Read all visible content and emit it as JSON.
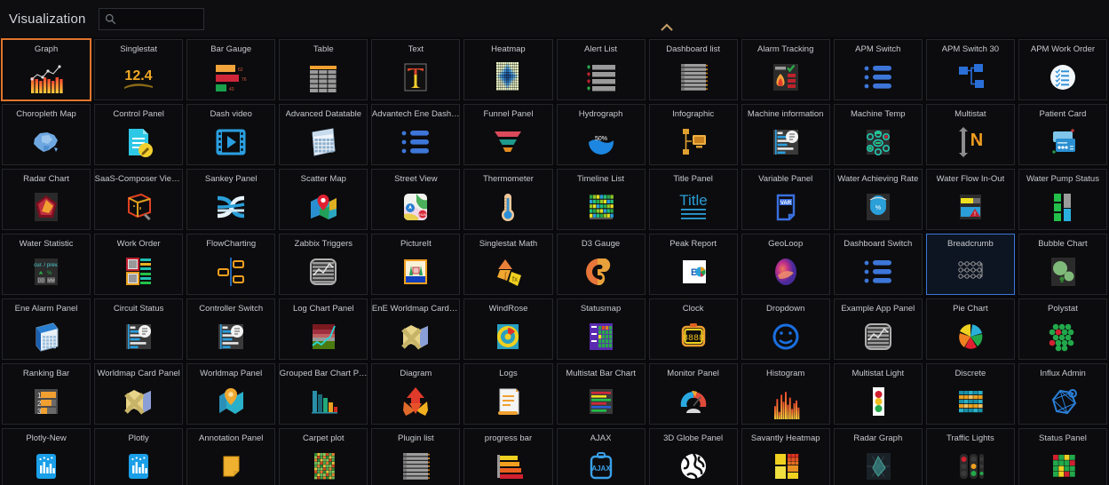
{
  "header": {
    "title": "Visualization",
    "search": {
      "value": "",
      "placeholder": ""
    },
    "collapse_icon": "chevron-up-icon",
    "search_icon": "search-icon"
  },
  "colors": {
    "selected_border": "#e0752d",
    "focus_border": "#3d76d8",
    "background": "#09090b",
    "card_background": "#0c0c0e",
    "card_border": "#242629",
    "label_text": "#c7c9cd"
  },
  "grid": {
    "columns": 12,
    "selected": "Graph",
    "focused": "Breadcrumb",
    "cards": [
      {
        "label": "Graph",
        "icon": "graph-icon",
        "state": "selected"
      },
      {
        "label": "Singlestat",
        "icon": "singlestat-icon",
        "state": "normal"
      },
      {
        "label": "Bar Gauge",
        "icon": "bar-gauge-icon",
        "state": "normal"
      },
      {
        "label": "Table",
        "icon": "table-icon",
        "state": "normal"
      },
      {
        "label": "Text",
        "icon": "text-icon",
        "state": "normal"
      },
      {
        "label": "Heatmap",
        "icon": "heatmap-icon",
        "state": "normal"
      },
      {
        "label": "Alert List",
        "icon": "alert-list-icon",
        "state": "normal"
      },
      {
        "label": "Dashboard list",
        "icon": "dashboard-list-icon",
        "state": "normal"
      },
      {
        "label": "Alarm Tracking",
        "icon": "alarm-tracking-icon",
        "state": "normal"
      },
      {
        "label": "APM Switch",
        "icon": "apm-switch-icon",
        "state": "normal"
      },
      {
        "label": "APM Switch 30",
        "icon": "apm-switch-30-icon",
        "state": "normal"
      },
      {
        "label": "APM Work Order",
        "icon": "apm-work-order-icon",
        "state": "normal"
      },
      {
        "label": "Choropleth Map",
        "icon": "choropleth-map-icon",
        "state": "normal"
      },
      {
        "label": "Control Panel",
        "icon": "control-panel-icon",
        "state": "normal"
      },
      {
        "label": "Dash video",
        "icon": "dash-video-icon",
        "state": "normal"
      },
      {
        "label": "Advanced Datatable",
        "icon": "advanced-datatable-icon",
        "state": "normal"
      },
      {
        "label": "Advantech Ene Dashbo...",
        "icon": "advantech-ene-dashboard-icon",
        "state": "normal"
      },
      {
        "label": "Funnel Panel",
        "icon": "funnel-panel-icon",
        "state": "normal"
      },
      {
        "label": "Hydrograph",
        "icon": "hydrograph-icon",
        "state": "normal"
      },
      {
        "label": "Infographic",
        "icon": "infographic-icon",
        "state": "normal"
      },
      {
        "label": "Machine information",
        "icon": "machine-information-icon",
        "state": "normal"
      },
      {
        "label": "Machine Temp",
        "icon": "machine-temp-icon",
        "state": "normal"
      },
      {
        "label": "Multistat",
        "icon": "multistat-icon",
        "state": "normal"
      },
      {
        "label": "Patient Card",
        "icon": "patient-card-icon",
        "state": "normal"
      },
      {
        "label": "Radar Chart",
        "icon": "radar-chart-icon",
        "state": "normal"
      },
      {
        "label": "SaaS-Composer Viewer",
        "icon": "saas-composer-viewer-icon",
        "state": "normal"
      },
      {
        "label": "Sankey Panel",
        "icon": "sankey-panel-icon",
        "state": "normal"
      },
      {
        "label": "Scatter Map",
        "icon": "scatter-map-icon",
        "state": "normal"
      },
      {
        "label": "Street View",
        "icon": "street-view-icon",
        "state": "normal"
      },
      {
        "label": "Thermometer",
        "icon": "thermometer-icon",
        "state": "normal"
      },
      {
        "label": "Timeline List",
        "icon": "timeline-list-icon",
        "state": "normal"
      },
      {
        "label": "Title Panel",
        "icon": "title-panel-icon",
        "state": "normal"
      },
      {
        "label": "Variable Panel",
        "icon": "variable-panel-icon",
        "state": "normal"
      },
      {
        "label": "Water Achieving Rate",
        "icon": "water-achieving-rate-icon",
        "state": "normal"
      },
      {
        "label": "Water Flow In-Out",
        "icon": "water-flow-in-out-icon",
        "state": "normal"
      },
      {
        "label": "Water Pump Status",
        "icon": "water-pump-status-icon",
        "state": "normal"
      },
      {
        "label": "Water Statistic",
        "icon": "water-statistic-icon",
        "state": "normal"
      },
      {
        "label": "Work Order",
        "icon": "work-order-icon",
        "state": "normal"
      },
      {
        "label": "FlowCharting",
        "icon": "flowcharting-icon",
        "state": "normal"
      },
      {
        "label": "Zabbix Triggers",
        "icon": "zabbix-triggers-icon",
        "state": "normal"
      },
      {
        "label": "PictureIt",
        "icon": "pictureit-icon",
        "state": "normal"
      },
      {
        "label": "Singlestat Math",
        "icon": "singlestat-math-icon",
        "state": "normal"
      },
      {
        "label": "D3 Gauge",
        "icon": "d3-gauge-icon",
        "state": "normal"
      },
      {
        "label": "Peak Report",
        "icon": "peak-report-icon",
        "state": "normal"
      },
      {
        "label": "GeoLoop",
        "icon": "geoloop-icon",
        "state": "normal"
      },
      {
        "label": "Dashboard Switch",
        "icon": "dashboard-switch-icon",
        "state": "normal"
      },
      {
        "label": "Breadcrumb",
        "icon": "breadcrumb-icon",
        "state": "focused"
      },
      {
        "label": "Bubble Chart",
        "icon": "bubble-chart-icon",
        "state": "normal"
      },
      {
        "label": "Ene Alarm Panel",
        "icon": "ene-alarm-panel-icon",
        "state": "normal"
      },
      {
        "label": "Circuit Status",
        "icon": "circuit-status-icon",
        "state": "normal"
      },
      {
        "label": "Controller Switch",
        "icon": "controller-switch-icon",
        "state": "normal"
      },
      {
        "label": "Log Chart Panel",
        "icon": "log-chart-panel-icon",
        "state": "normal"
      },
      {
        "label": "EnE Worldmap Card Panel",
        "icon": "ene-worldmap-card-panel-icon",
        "state": "normal"
      },
      {
        "label": "WindRose",
        "icon": "windrose-icon",
        "state": "normal"
      },
      {
        "label": "Statusmap",
        "icon": "statusmap-icon",
        "state": "normal"
      },
      {
        "label": "Clock",
        "icon": "clock-icon",
        "state": "normal"
      },
      {
        "label": "Dropdown",
        "icon": "dropdown-icon",
        "state": "normal"
      },
      {
        "label": "Example App Panel",
        "icon": "example-app-panel-icon",
        "state": "normal"
      },
      {
        "label": "Pie Chart",
        "icon": "pie-chart-icon",
        "state": "normal"
      },
      {
        "label": "Polystat",
        "icon": "polystat-icon",
        "state": "normal"
      },
      {
        "label": "Ranking Bar",
        "icon": "ranking-bar-icon",
        "state": "normal"
      },
      {
        "label": "Worldmap Card Panel",
        "icon": "worldmap-card-panel-icon",
        "state": "normal"
      },
      {
        "label": "Worldmap Panel",
        "icon": "worldmap-panel-icon",
        "state": "normal"
      },
      {
        "label": "Grouped Bar Chart Panel",
        "icon": "grouped-bar-chart-panel-icon",
        "state": "normal"
      },
      {
        "label": "Diagram",
        "icon": "diagram-icon",
        "state": "normal"
      },
      {
        "label": "Logs",
        "icon": "logs-icon",
        "state": "normal"
      },
      {
        "label": "Multistat Bar Chart",
        "icon": "multistat-bar-chart-icon",
        "state": "normal"
      },
      {
        "label": "Monitor Panel",
        "icon": "monitor-panel-icon",
        "state": "normal"
      },
      {
        "label": "Histogram",
        "icon": "histogram-icon",
        "state": "normal"
      },
      {
        "label": "Multistat Light",
        "icon": "multistat-light-icon",
        "state": "normal"
      },
      {
        "label": "Discrete",
        "icon": "discrete-icon",
        "state": "normal"
      },
      {
        "label": "Influx Admin",
        "icon": "influx-admin-icon",
        "state": "normal"
      },
      {
        "label": "Plotly-New",
        "icon": "plotly-new-icon",
        "state": "normal"
      },
      {
        "label": "Plotly",
        "icon": "plotly-icon",
        "state": "normal"
      },
      {
        "label": "Annotation Panel",
        "icon": "annotation-panel-icon",
        "state": "normal"
      },
      {
        "label": "Carpet plot",
        "icon": "carpet-plot-icon",
        "state": "normal"
      },
      {
        "label": "Plugin list",
        "icon": "plugin-list-icon",
        "state": "normal"
      },
      {
        "label": "progress bar",
        "icon": "progress-bar-icon",
        "state": "normal"
      },
      {
        "label": "AJAX",
        "icon": "ajax-icon",
        "state": "normal"
      },
      {
        "label": "3D Globe Panel",
        "icon": "3d-globe-panel-icon",
        "state": "normal"
      },
      {
        "label": "Savantly Heatmap",
        "icon": "savantly-heatmap-icon",
        "state": "normal"
      },
      {
        "label": "Radar Graph",
        "icon": "radar-graph-icon",
        "state": "normal"
      },
      {
        "label": "Traffic Lights",
        "icon": "traffic-lights-icon",
        "state": "normal"
      },
      {
        "label": "Status Panel",
        "icon": "status-panel-icon",
        "state": "normal"
      }
    ]
  }
}
